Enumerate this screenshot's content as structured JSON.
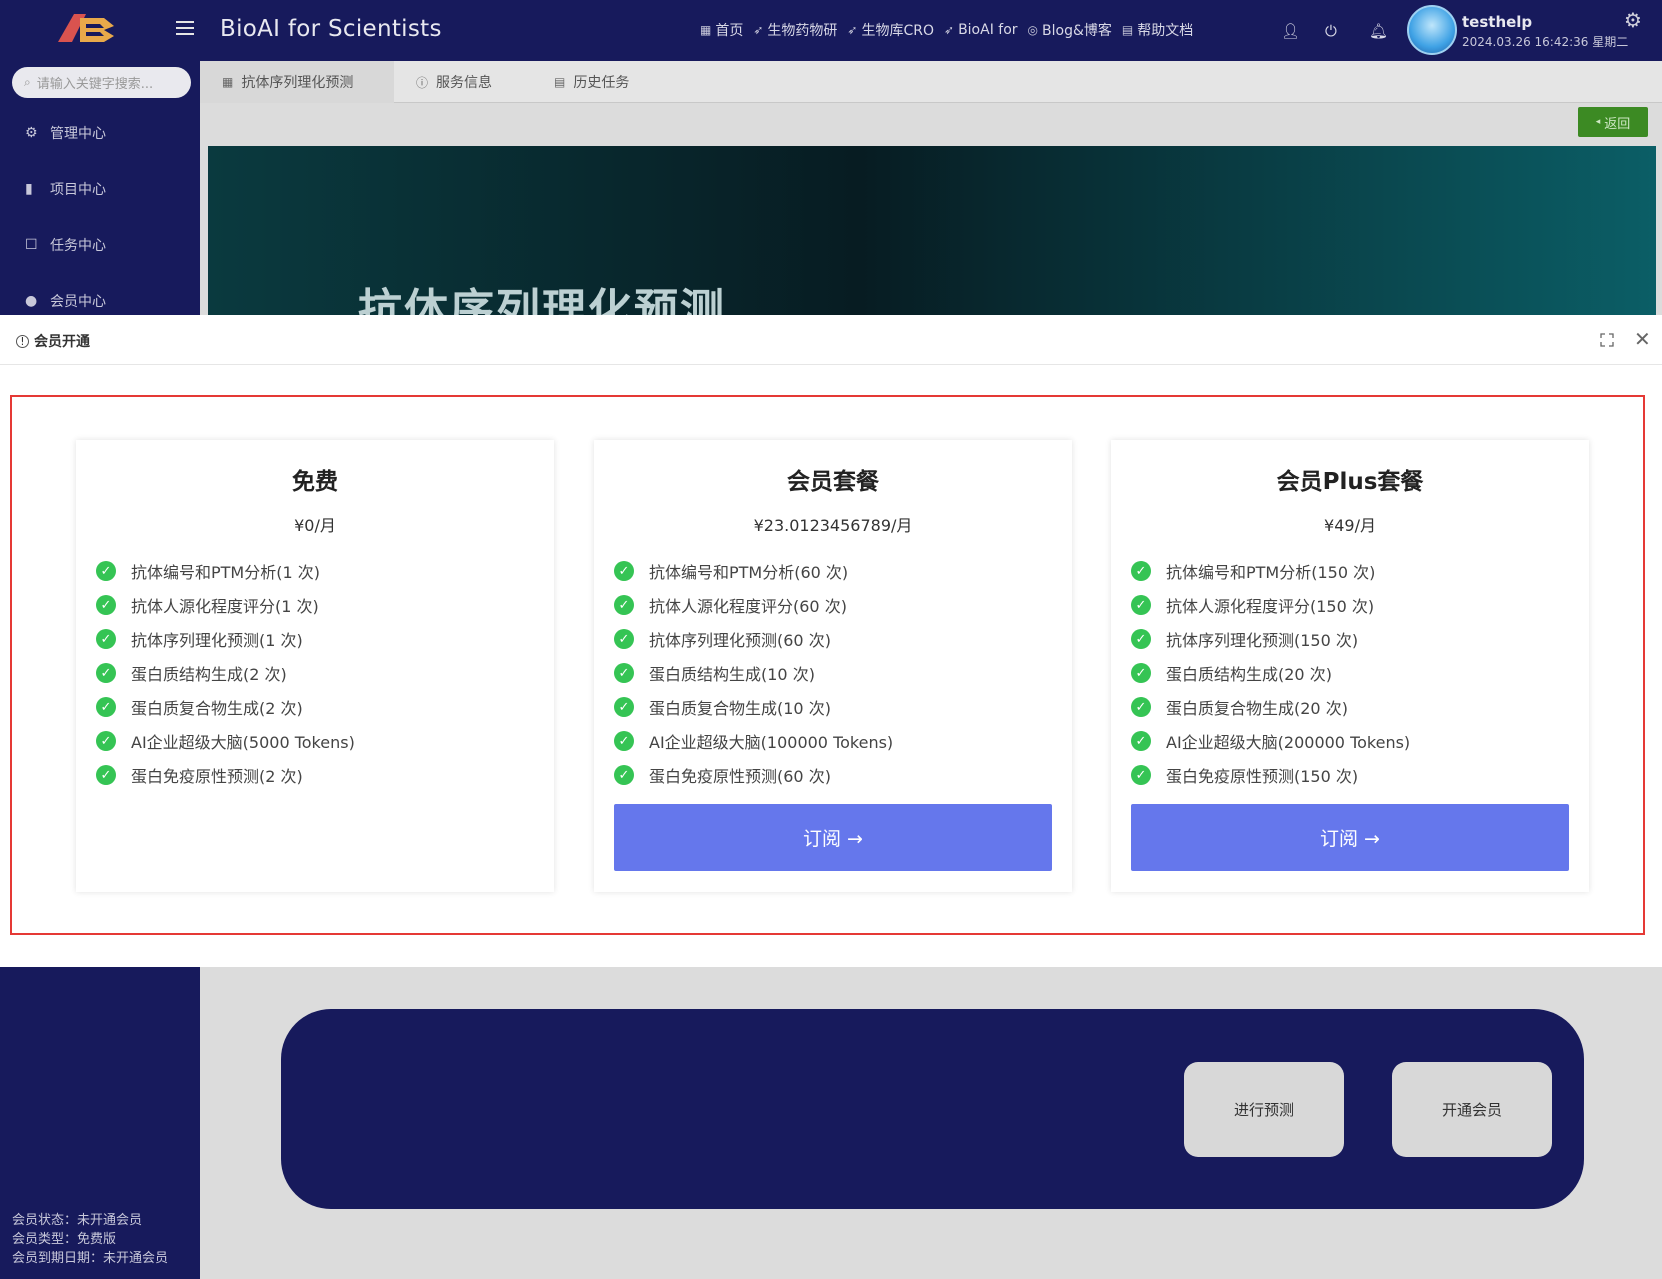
{
  "header": {
    "app_title": "BioAI for Scientists",
    "nav": [
      {
        "icon": "grid-icon",
        "label": "首页"
      },
      {
        "icon": "send-icon",
        "label": "生物药物研"
      },
      {
        "icon": "send-icon",
        "label": "生物库CRO"
      },
      {
        "icon": "send-icon",
        "label": "BioAI for"
      },
      {
        "icon": "chat-icon",
        "label": "Blog&博客"
      },
      {
        "icon": "doc-icon",
        "label": "帮助文档"
      }
    ],
    "user": {
      "name": "testhelp",
      "datetime": "2024.03.26 16:42:36 星期二"
    }
  },
  "sidebar": {
    "search_placeholder": "请输入关键字搜索...",
    "items": [
      {
        "icon": "gear-icon",
        "label": "管理中心"
      },
      {
        "icon": "bar-chart-icon",
        "label": "项目中心"
      },
      {
        "icon": "task-icon",
        "label": "任务中心"
      },
      {
        "icon": "user-icon",
        "label": "会员中心"
      }
    ],
    "member_status": "会员状态：未开通会员",
    "member_type": "会员类型：免费版",
    "member_expiry": "会员到期日期：未开通会员"
  },
  "tabs": [
    {
      "icon": "grid-icon",
      "label": "抗体序列理化预测"
    },
    {
      "icon": "info-icon",
      "label": "服务信息"
    },
    {
      "icon": "doc-icon",
      "label": "历史任务"
    }
  ],
  "return_label": "返回",
  "banner_title": "抗体序列理化预测",
  "actions": {
    "predict": "进行预测",
    "open_member": "开通会员"
  },
  "modal": {
    "title": "会员开通",
    "plans": [
      {
        "name": "免费",
        "price": "¥0/月",
        "features": [
          "抗体编号和PTM分析(1 次)",
          "抗体人源化程度评分(1 次)",
          "抗体序列理化预测(1 次)",
          "蛋白质结构生成(2 次)",
          "蛋白质复合物生成(2 次)",
          "AI企业超级大脑(5000 Tokens)",
          "蛋白免疫原性预测(2 次)"
        ],
        "button": ""
      },
      {
        "name": "会员套餐",
        "price": "¥23.0123456789/月",
        "features": [
          "抗体编号和PTM分析(60 次)",
          "抗体人源化程度评分(60 次)",
          "抗体序列理化预测(60 次)",
          "蛋白质结构生成(10 次)",
          "蛋白质复合物生成(10 次)",
          "AI企业超级大脑(100000 Tokens)",
          "蛋白免疫原性预测(60 次)"
        ],
        "button": "订阅 →"
      },
      {
        "name": "会员Plus套餐",
        "price": "¥49/月",
        "features": [
          "抗体编号和PTM分析(150 次)",
          "抗体人源化程度评分(150 次)",
          "抗体序列理化预测(150 次)",
          "蛋白质结构生成(20 次)",
          "蛋白质复合物生成(20 次)",
          "AI企业超级大脑(200000 Tokens)",
          "蛋白免疫原性预测(150 次)"
        ],
        "button": "订阅 →"
      }
    ]
  },
  "colors": {
    "nav_bg": "#171a5c",
    "accent": "#6577ec",
    "check": "#35c454",
    "highlight": "#e53935",
    "return": "#3c8a23"
  }
}
